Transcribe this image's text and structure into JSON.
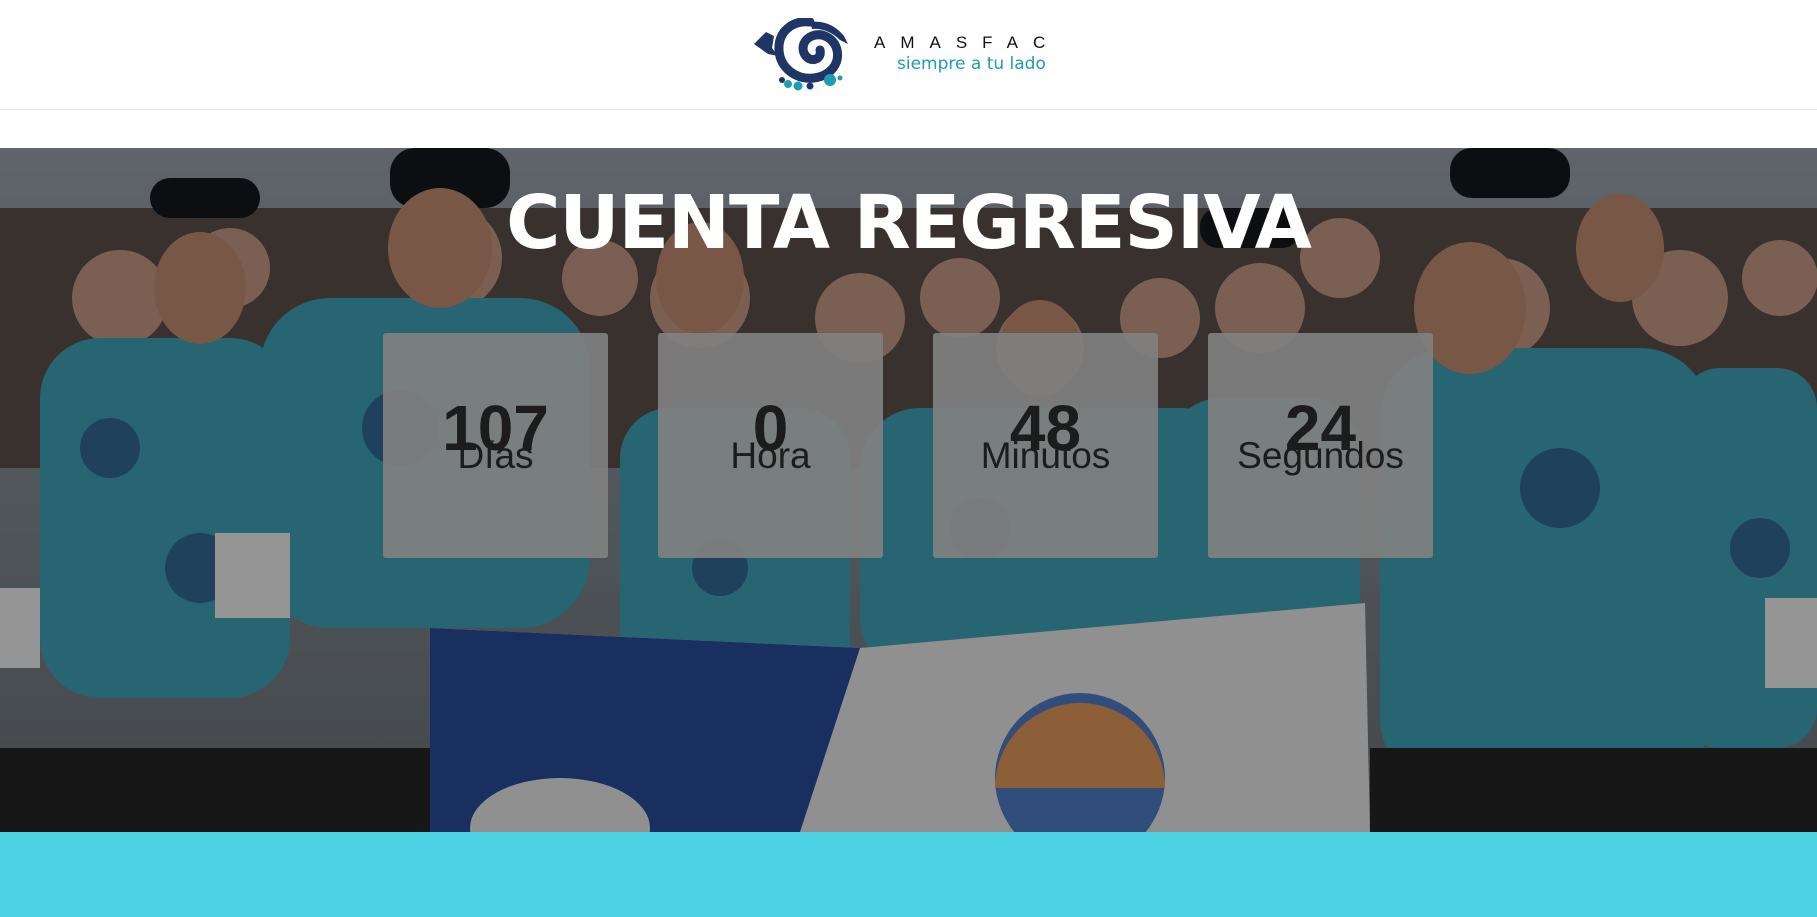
{
  "brand": {
    "name": "AMASFAC",
    "tagline": "siempre a tu lado",
    "colors": {
      "navy": "#1f3566",
      "teal": "#1f9bb3"
    }
  },
  "hero": {
    "title": "CUENTA REGRESIVA",
    "photo_icon": "runners-crowd-photo"
  },
  "countdown": [
    {
      "value": "107",
      "label": "Días"
    },
    {
      "value": "0",
      "label": "Hora"
    },
    {
      "value": "48",
      "label": "Minutos"
    },
    {
      "value": "24",
      "label": "Segundos"
    }
  ],
  "colors": {
    "accent_band": "#4bd2e3",
    "box_bg": "#808080",
    "text_dark": "#1c1c1c"
  }
}
